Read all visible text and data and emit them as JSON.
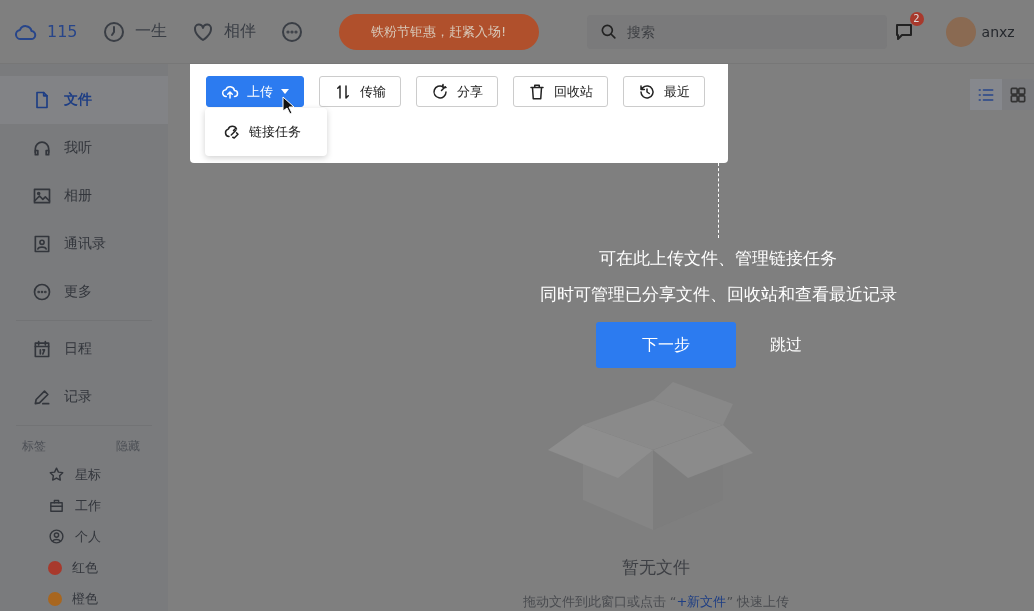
{
  "top_bar": {
    "nav": [
      {
        "kind": "cloud",
        "label": "115",
        "accent": true
      },
      {
        "kind": "clock",
        "label": "一生",
        "accent": false
      },
      {
        "kind": "heart",
        "label": "相伴",
        "accent": false
      }
    ],
    "promo": "铁粉节钜惠，赶紧入场!",
    "search": {
      "placeholder": "搜索"
    },
    "messages_badge": "2",
    "user": "anxz"
  },
  "sidebar": {
    "sections": [
      [
        {
          "kind": "file",
          "label": "文件",
          "selected": true
        },
        {
          "kind": "headphones",
          "label": "我听",
          "selected": false
        },
        {
          "kind": "image",
          "label": "相册",
          "selected": false
        },
        {
          "kind": "contact",
          "label": "通讯录",
          "selected": false
        },
        {
          "kind": "more",
          "label": "更多",
          "selected": false
        }
      ],
      [
        {
          "kind": "calendar",
          "label": "日程",
          "selected": false
        },
        {
          "kind": "pen",
          "label": "记录",
          "selected": false
        }
      ]
    ],
    "tags_header": {
      "title": "标签",
      "action": "隐藏"
    },
    "tags": [
      {
        "kind": "star",
        "label": "星标"
      },
      {
        "kind": "briefcase",
        "label": "工作"
      },
      {
        "kind": "person",
        "label": "个人"
      },
      {
        "kind": "dot",
        "label": "红色",
        "color": "#a8392c"
      },
      {
        "kind": "dot",
        "label": "橙色",
        "color": "#a8661f"
      }
    ]
  },
  "toolbar": {
    "buttons": [
      {
        "kind": "upload",
        "label": "上传",
        "primary": true
      },
      {
        "kind": "transfer",
        "label": "传输",
        "primary": false
      },
      {
        "kind": "share",
        "label": "分享",
        "primary": false
      },
      {
        "kind": "trash",
        "label": "回收站",
        "primary": false
      },
      {
        "kind": "history",
        "label": "最近",
        "primary": false
      }
    ],
    "upload_menu": [
      {
        "kind": "link",
        "label": "链接任务"
      }
    ]
  },
  "view_toggle": [
    {
      "kind": "list",
      "selected": true
    },
    {
      "kind": "grid",
      "selected": false
    }
  ],
  "guide": {
    "lines": [
      "可在此上传文件、管理链接任务",
      "同时可管理已分享文件、回收站和查看最近记录"
    ],
    "next": "下一步",
    "skip": "跳过"
  },
  "empty": {
    "title": "暂无文件",
    "hint_before": "拖动文件到此窗口或点击 “",
    "hint_link": "+新文件",
    "hint_after": "” 快速上传"
  }
}
